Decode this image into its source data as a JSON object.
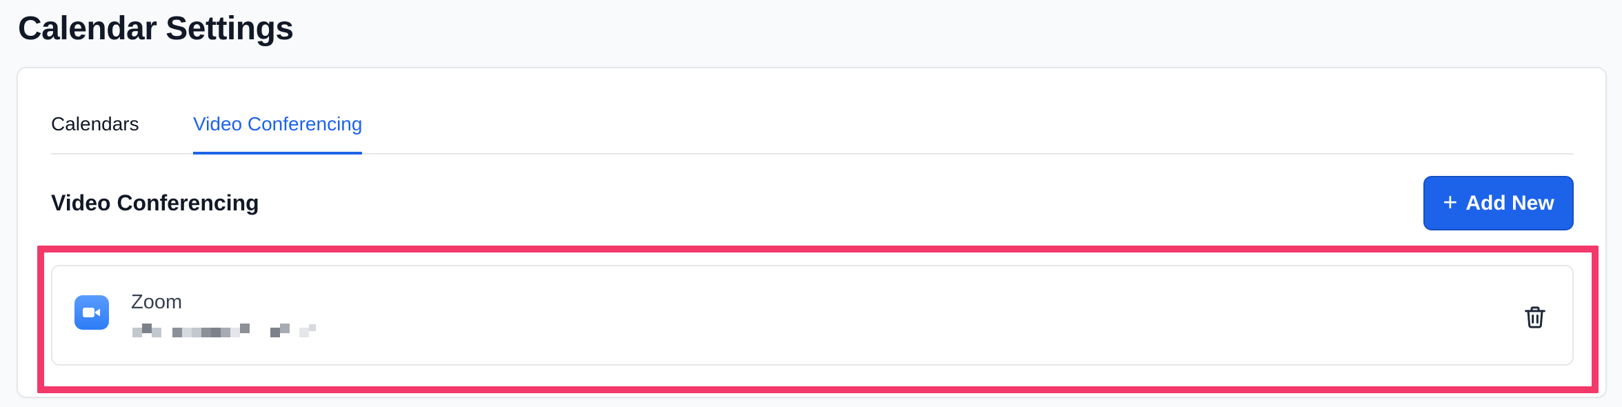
{
  "page": {
    "title": "Calendar Settings"
  },
  "tabs": [
    {
      "label": "Calendars",
      "active": false
    },
    {
      "label": "Video Conferencing",
      "active": true
    }
  ],
  "section": {
    "title": "Video Conferencing",
    "add_button_label": "Add New",
    "add_button_icon": "plus-icon"
  },
  "integration": {
    "name": "Zoom",
    "icon": "zoom-video-camera-icon",
    "account_email_redacted": true,
    "delete_icon": "trash-icon"
  },
  "colors": {
    "accent": "#1d63ea",
    "highlight_border": "#f3386a",
    "zoom_blue": "#2d7cf6"
  }
}
